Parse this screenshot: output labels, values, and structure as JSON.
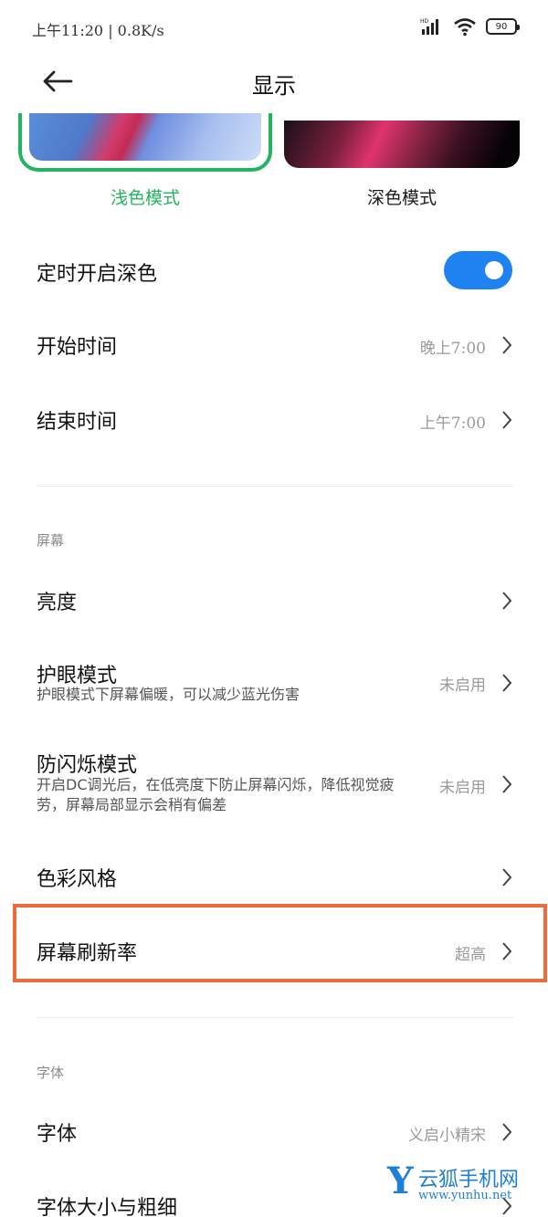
{
  "status_bar": {
    "time_speed": "上午11:20 | 0.8K/s",
    "battery": "90"
  },
  "header": {
    "title": "显示"
  },
  "theme": {
    "light_label": "浅色模式",
    "dark_label": "深色模式",
    "selected": "light",
    "accent_color": "#22b45f"
  },
  "dark_schedule": {
    "title": "定时开启深色",
    "enabled": true,
    "start": {
      "title": "开始时间",
      "value": "晚上7:00"
    },
    "end": {
      "title": "结束时间",
      "value": "上午7:00"
    }
  },
  "screen_section": {
    "header": "屏幕",
    "items": [
      {
        "title": "亮度",
        "value": ""
      },
      {
        "title": "护眼模式",
        "subtitle": "护眼模式下屏幕偏暖，可以减少蓝光伤害",
        "value": "未启用"
      },
      {
        "title": "防闪烁模式",
        "subtitle": "开启DC调光后，在低亮度下防止屏幕闪烁，降低视觉疲劳，屏幕局部显示会稍有偏差",
        "value": "未启用"
      },
      {
        "title": "色彩风格",
        "value": ""
      },
      {
        "title": "屏幕刷新率",
        "value": "超高"
      }
    ]
  },
  "font_section": {
    "header": "字体",
    "items": [
      {
        "title": "字体",
        "value": "义启小精宋"
      },
      {
        "title": "字体大小与粗细",
        "value": ""
      }
    ]
  },
  "watermark": {
    "letter": "Y",
    "name": "云狐手机网",
    "url": "www.yunhu.net"
  },
  "colors": {
    "toggle_on": "#1e82f0",
    "highlight": "#ec6b3d"
  }
}
